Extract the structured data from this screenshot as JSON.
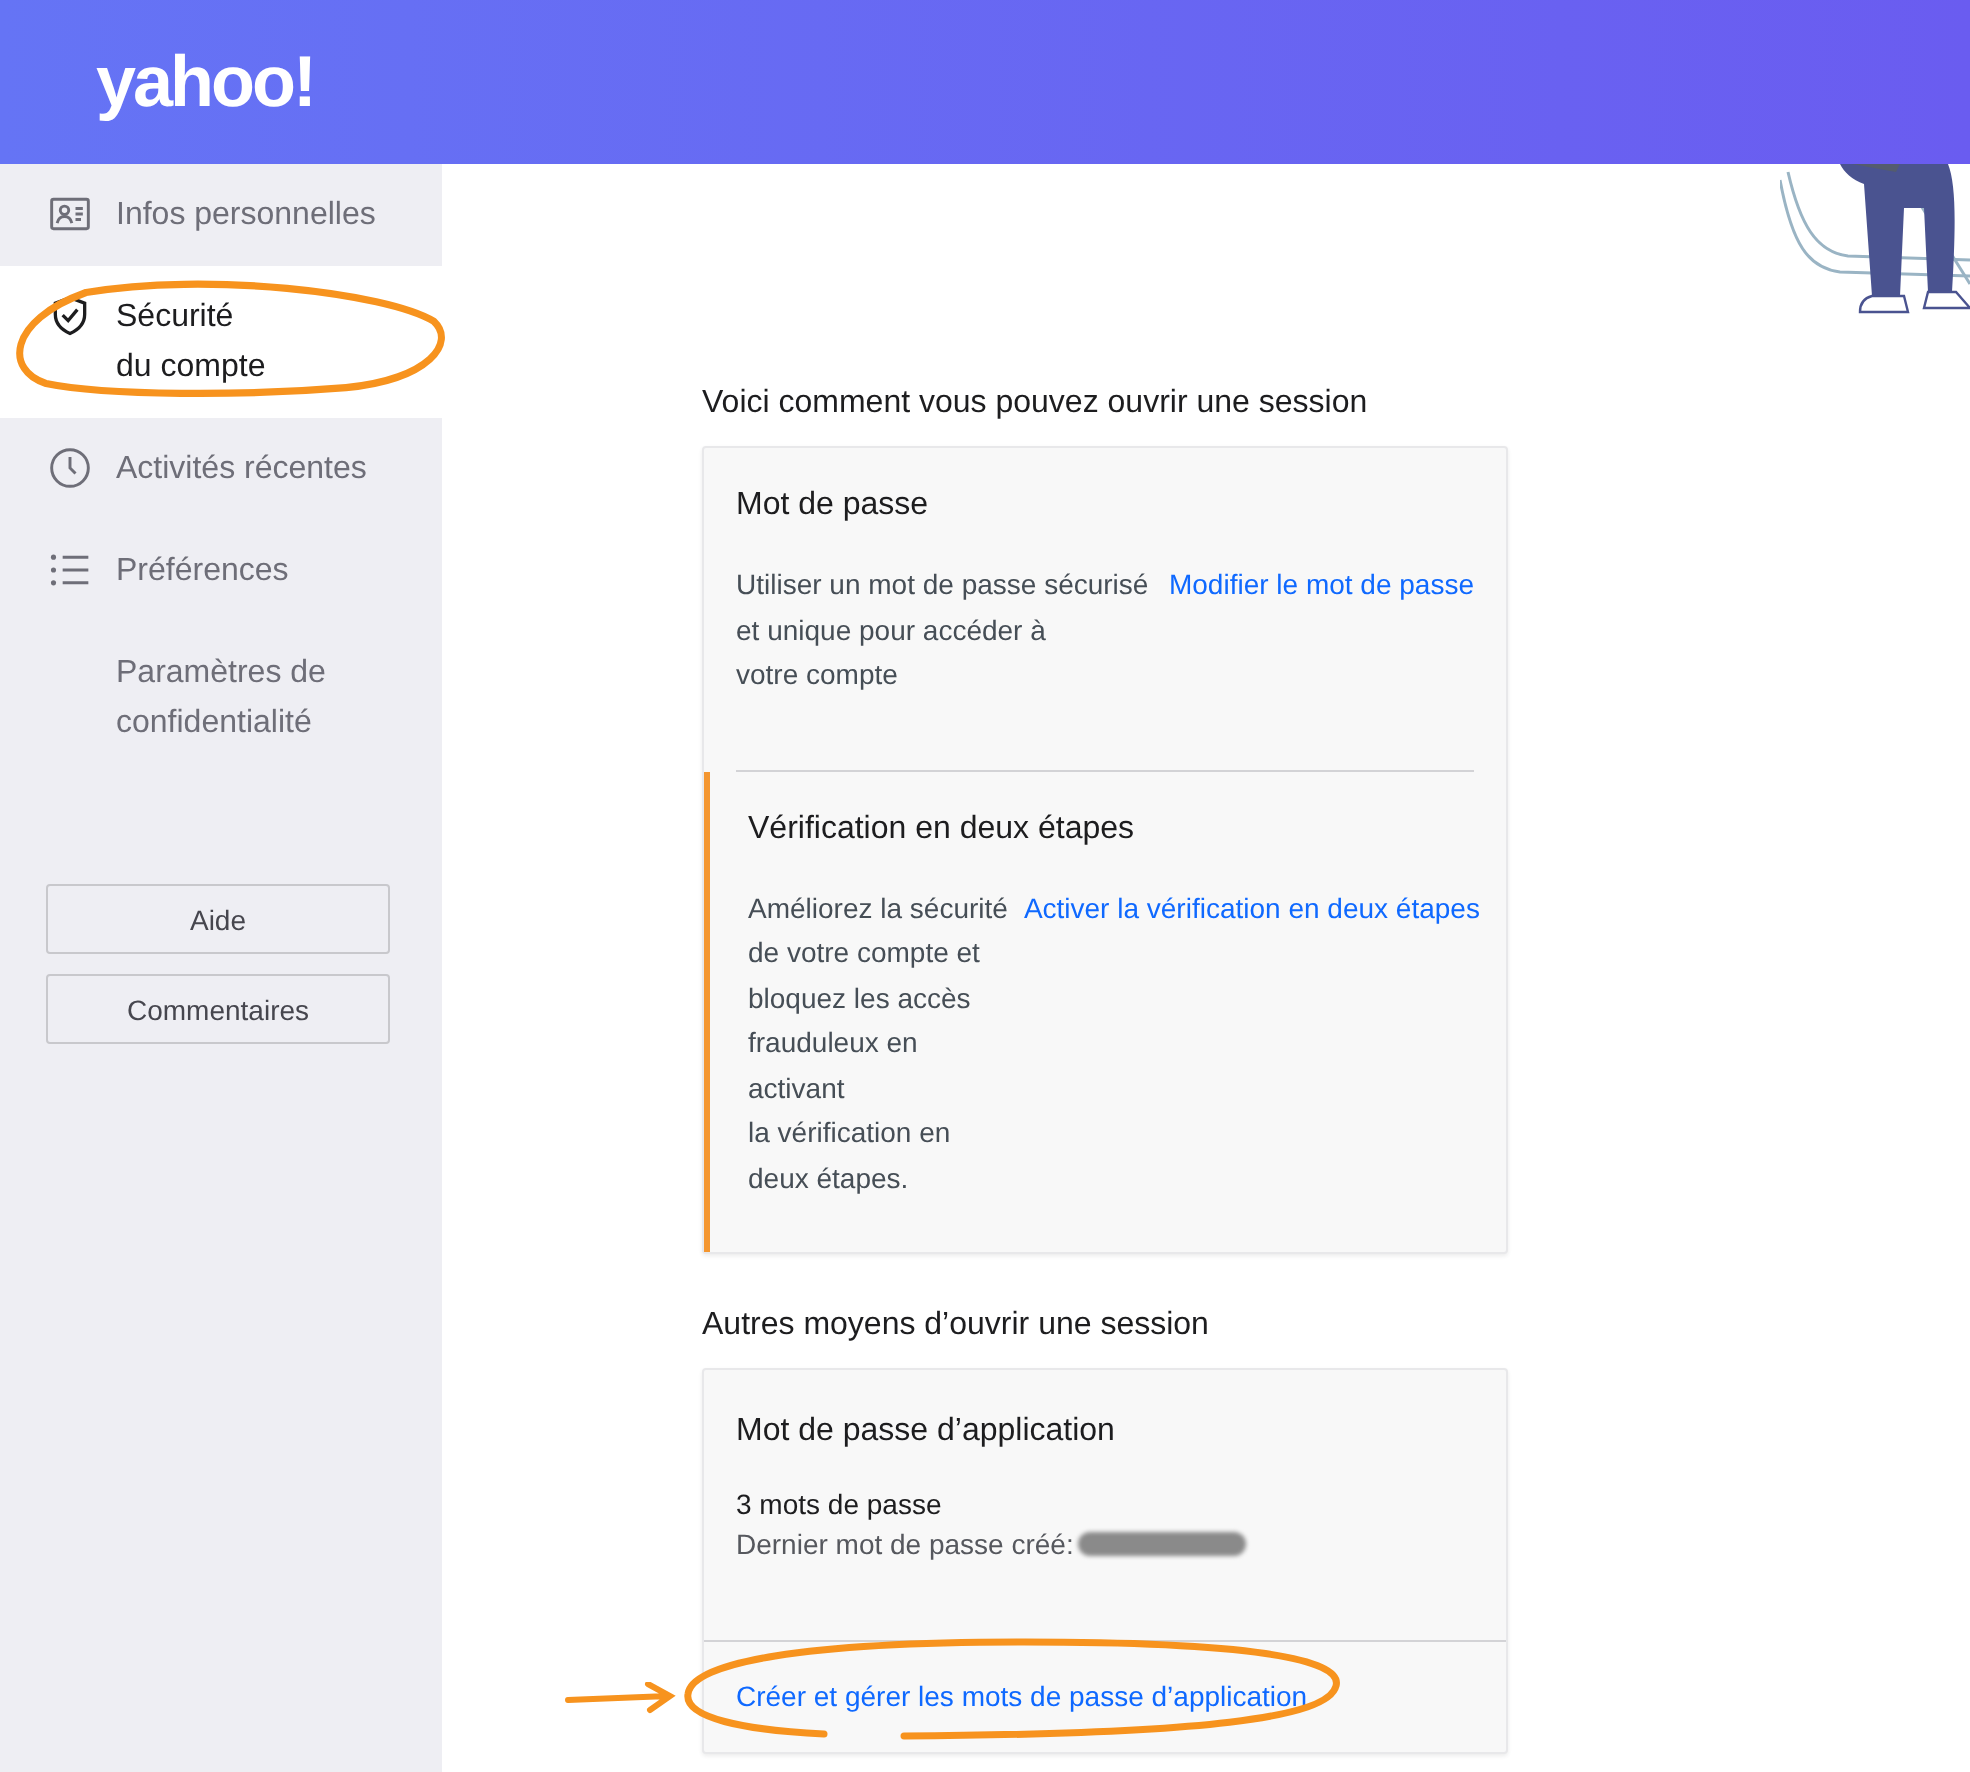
{
  "header": {
    "logo": "yahoo!"
  },
  "sidebar": {
    "items": [
      {
        "label": "Infos personnelles",
        "selected": false,
        "circled": false
      },
      {
        "label": "Sécurité\ndu compte",
        "selected": true,
        "circled": true
      },
      {
        "label": "Activités récentes",
        "selected": false,
        "circled": false
      },
      {
        "label": "Préférences",
        "selected": false,
        "circled": false
      },
      {
        "label": "Paramètres de\nconfidentialité",
        "selected": false,
        "circled": false
      }
    ],
    "buttons": [
      "Aide",
      "Commentaires"
    ]
  },
  "sections": [
    {
      "heading": "Voici comment vous pouvez ouvrir une session",
      "cards": [
        {
          "kind": "option",
          "title": "Mot de passe",
          "description": "Utiliser un mot de passe sécurisé\net unique pour accéder à\nvotre compte",
          "link": "Modifier le mot de passe",
          "highlighted": false
        },
        {
          "kind": "option",
          "title": "Vérification en deux étapes",
          "description": "Améliorez la sécurité\nde votre compte et\nbloquez les accès\nfrauduleux en\nactivant\nla vérification en\ndeux étapes.",
          "link": "Activer la vérification en deux étapes",
          "highlighted": true
        }
      ]
    },
    {
      "heading": "Autres moyens d’ouvrir une session",
      "cards": [
        {
          "kind": "app_passwords",
          "title": "Mot de passe d’application",
          "count": "3 mots de passe",
          "last_created": "Dernier mot de passe créé:",
          "redacted": true,
          "link": "Créer et gérer les mots de passe d’application",
          "circled": true,
          "arrow": true
        }
      ]
    }
  ]
}
